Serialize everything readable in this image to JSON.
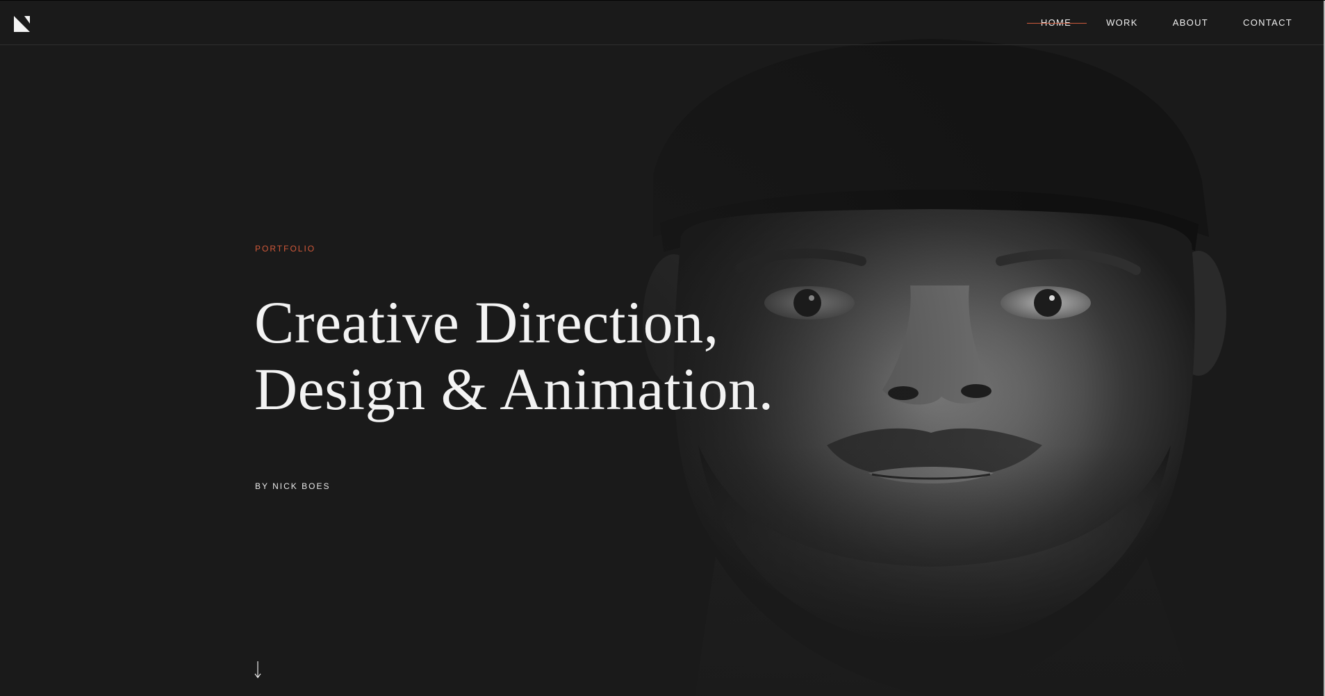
{
  "header": {
    "logo_icon": "n-monogram-logo-icon",
    "nav": [
      {
        "label": "HOME",
        "active": true
      },
      {
        "label": "WORK",
        "active": false
      },
      {
        "label": "ABOUT",
        "active": false
      },
      {
        "label": "CONTACT",
        "active": false
      }
    ]
  },
  "hero": {
    "eyebrow": "PORTFOLIO",
    "headline_line1": "Creative Direction,",
    "headline_line2": "Design & Animation.",
    "byline": "BY NICK BOES",
    "scroll_icon": "arrow-down-icon"
  },
  "colors": {
    "background": "#1a1a1a",
    "accent": "#d2593a",
    "text": "#f3f3f3"
  }
}
